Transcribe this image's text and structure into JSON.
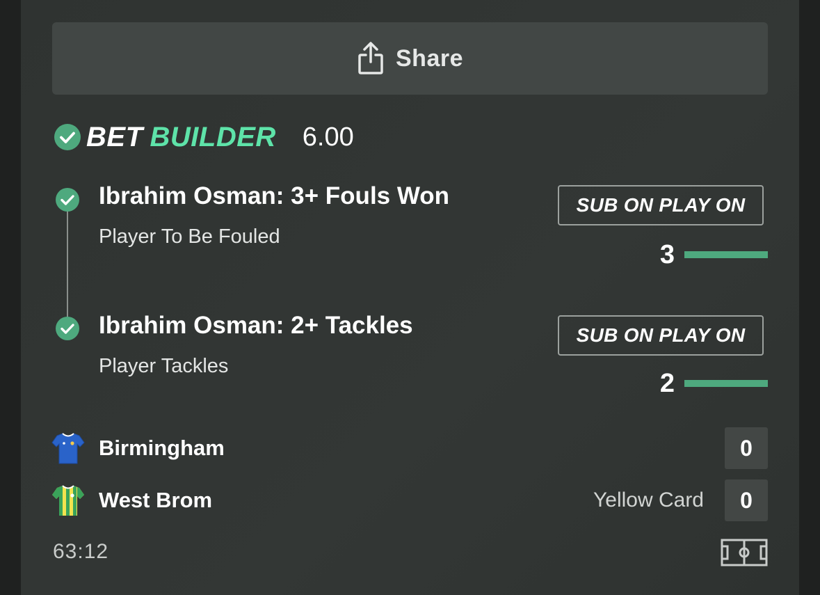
{
  "share": {
    "label": "Share",
    "icon": "share-icon"
  },
  "bet_builder": {
    "word1": "BET",
    "word2": "BUILDER",
    "odds": "6.00",
    "accent_color": "#5ee3a9"
  },
  "legs": [
    {
      "title": "Ibrahim Osman: 3+ Fouls Won",
      "market": "Player To Be Fouled",
      "badge": "SUB ON PLAY ON",
      "progress_value": "3",
      "progress_fraction": 1.0
    },
    {
      "title": "Ibrahim Osman: 2+ Tackles",
      "market": "Player Tackles",
      "badge": "SUB ON PLAY ON",
      "progress_value": "2",
      "progress_fraction": 1.0
    }
  ],
  "teams": [
    {
      "name": "Birmingham",
      "score": "0",
      "event": "",
      "shirt": "blue-shirt-icon"
    },
    {
      "name": "West Brom",
      "score": "0",
      "event": "Yellow Card",
      "shirt": "green-yellow-striped-shirt-icon"
    }
  ],
  "match_clock": "63:12",
  "icons": {
    "pitch": "pitch-icon",
    "check": "check-circle-icon"
  },
  "colors": {
    "progress_fill": "#4ea97e",
    "check_green": "#4ea97e"
  }
}
